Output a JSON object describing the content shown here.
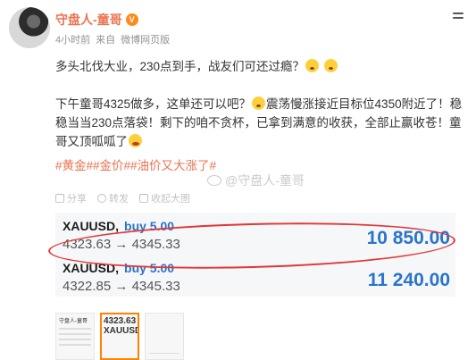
{
  "author": {
    "name": "守盘人-童哥",
    "vip_badge": "V"
  },
  "meta": {
    "time": "4小时前",
    "source_prefix": "来自",
    "source": "微博网页版"
  },
  "content": {
    "line1": "多头北伐大业，230点到手，战友们可还过瘾？",
    "para2": "下午童哥4325做多，这单还可以吧？",
    "para2b": "震荡慢涨接近目标位4350附近了！稳稳当当230点落袋！剩下的咱不贪杯，已拿到满意的收获，全部止赢收苍！童哥又顶呱呱了",
    "hashtags": "#黄金##金价##油价又大涨了#"
  },
  "watermark": "@守盘人-童哥",
  "actions": {
    "share": "分享",
    "repost": "转发",
    "collapse": "收起大图"
  },
  "trades": [
    {
      "symbol": "XAUUSD,",
      "side": "buy 5.00",
      "open": "4323.63",
      "arrow": "→",
      "close": "4345.33",
      "profit": "10 850.00"
    },
    {
      "symbol": "XAUUSD,",
      "side": "buy 5.00",
      "open": "4322.85",
      "arrow": "→",
      "close": "4345.33",
      "profit": "11 240.00"
    }
  ],
  "thumbnails": [
    {
      "title": "守盘人-童哥",
      "big": ""
    },
    {
      "title": "",
      "big": "4323.63",
      "sub": "XAUUSD"
    },
    {
      "title": "",
      "big": ""
    }
  ],
  "colors": {
    "accent": "#eb7350",
    "profit_blue": "#2a74c9",
    "circle_red": "#e23636",
    "thumb_active": "#ff8200"
  }
}
